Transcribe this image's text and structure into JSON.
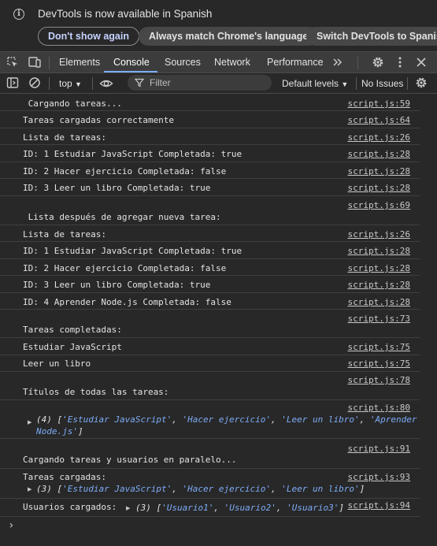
{
  "infobar": {
    "message": "DevTools is now available in Spanish",
    "dont_show": "Don't show again",
    "match_language": "Always match Chrome's language",
    "switch_language": "Switch DevTools to Spanish"
  },
  "tabs": [
    "Elements",
    "Console",
    "Sources",
    "Network",
    "Performance"
  ],
  "toolbar": {
    "context": "top",
    "filter_placeholder": "Filter",
    "levels": "Default levels",
    "issues": "No Issues"
  },
  "console_messages": [
    {
      "text": " Cargando tareas...",
      "source": "script.js:59"
    },
    {
      "text": "Tareas cargadas correctamente",
      "source": "script.js:64"
    },
    {
      "text": "Lista de tareas:",
      "source": "script.js:26"
    },
    {
      "text": "ID: 1 Estudiar JavaScript Completada: true",
      "source": "script.js:28"
    },
    {
      "text": "ID: 2 Hacer ejercicio Completada: false",
      "source": "script.js:28"
    },
    {
      "text": "ID: 3 Leer un libro Completada: true",
      "source": "script.js:28"
    },
    {
      "text": "",
      "source": "script.js:69"
    },
    {
      "text": " Lista después de agregar nueva tarea:",
      "source": ""
    },
    {
      "text": "Lista de tareas:",
      "source": "script.js:26"
    },
    {
      "text": "ID: 1 Estudiar JavaScript Completada: true",
      "source": "script.js:28"
    },
    {
      "text": "ID: 2 Hacer ejercicio Completada: false",
      "source": "script.js:28"
    },
    {
      "text": "ID: 3 Leer un libro Completada: true",
      "source": "script.js:28"
    },
    {
      "text": "ID: 4 Aprender Node.js Completada: false",
      "source": "script.js:28"
    },
    {
      "text": "",
      "source": "script.js:73"
    },
    {
      "text": "Tareas completadas:",
      "source": ""
    },
    {
      "text": "Estudiar JavaScript",
      "source": "script.js:75"
    },
    {
      "text": "Leer un libro",
      "source": "script.js:75"
    },
    {
      "text": "",
      "source": "script.js:78"
    },
    {
      "text": "Títulos de todas las tareas:",
      "source": ""
    },
    {
      "text": "",
      "source": "script.js:80"
    },
    {
      "text": "",
      "source": "script.js:91"
    },
    {
      "text": "Cargando tareas y usuarios en paralelo...",
      "source": ""
    },
    {
      "text": "Tareas cargadas:",
      "source": "script.js:93"
    },
    {
      "text": "Usuarios cargados:",
      "source": "script.js:94"
    }
  ],
  "arrays": {
    "titles": {
      "count": "(4) [",
      "items": [
        "'Estudiar JavaScript'",
        "'Hacer ejercicio'",
        "'Leer un libro'",
        "'Aprender",
        "Node.js'"
      ],
      "close": "]"
    },
    "tasks": {
      "count": "(3) [",
      "items": [
        "'Estudiar JavaScript'",
        "'Hacer ejercicio'",
        "'Leer un libro'"
      ],
      "close": "]"
    },
    "users": {
      "count": "(3) [",
      "items": [
        "'Usuario1'",
        "'Usuario2'",
        "'Usuario3'"
      ],
      "close": "]"
    }
  }
}
